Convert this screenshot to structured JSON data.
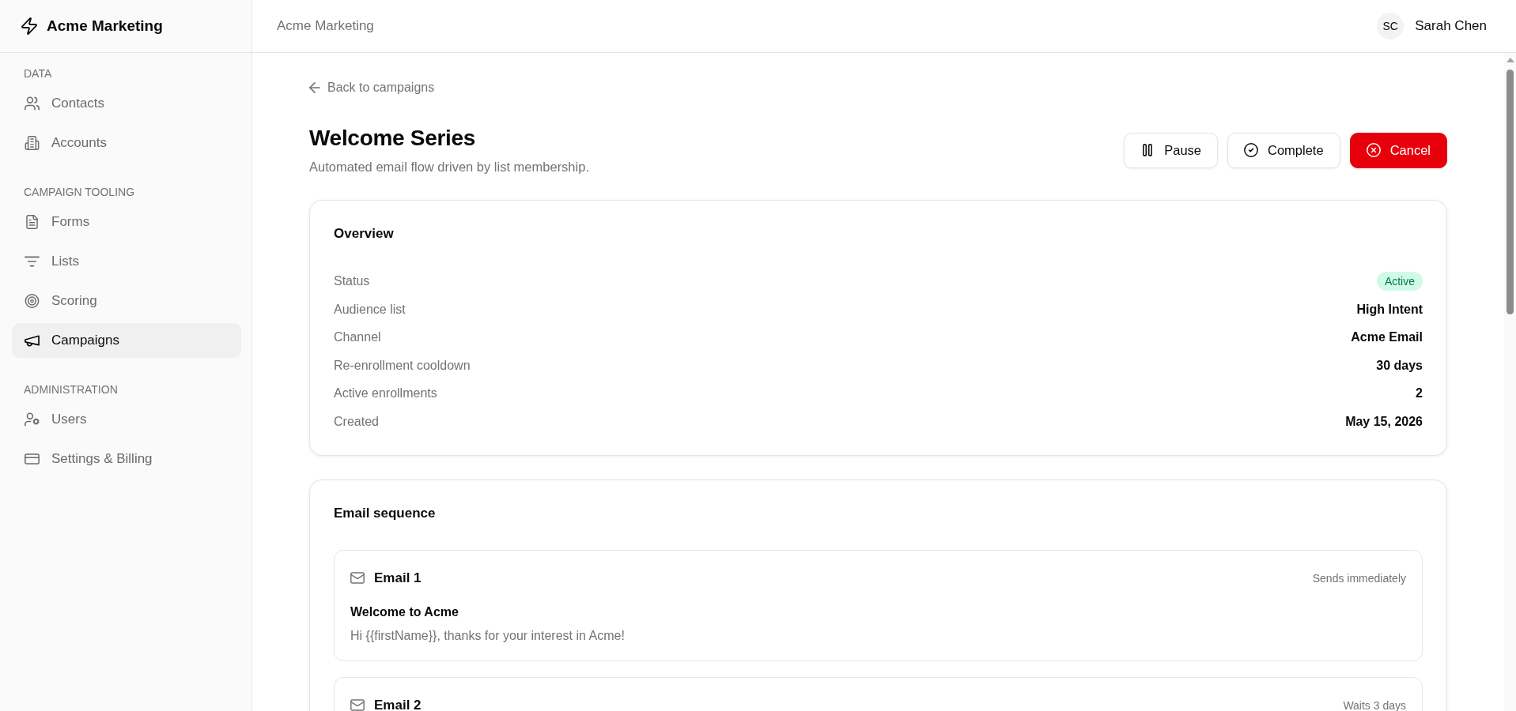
{
  "sidebar": {
    "brand": "Acme Marketing",
    "sections": [
      {
        "label": "DATA",
        "items": [
          {
            "label": "Contacts",
            "selected": false
          },
          {
            "label": "Accounts",
            "selected": false
          }
        ]
      },
      {
        "label": "CAMPAIGN TOOLING",
        "items": [
          {
            "label": "Forms",
            "selected": false
          },
          {
            "label": "Lists",
            "selected": false
          },
          {
            "label": "Scoring",
            "selected": false
          },
          {
            "label": "Campaigns",
            "selected": true
          }
        ]
      },
      {
        "label": "ADMINISTRATION",
        "items": [
          {
            "label": "Users",
            "selected": false
          },
          {
            "label": "Settings & Billing",
            "selected": false
          }
        ]
      }
    ]
  },
  "header": {
    "title": "Acme Marketing",
    "user": {
      "initials": "SC",
      "name": "Sarah Chen"
    }
  },
  "back_link": "Back to campaigns",
  "page": {
    "title": "Welcome Series",
    "subtitle": "Automated email flow driven by list membership."
  },
  "actions": [
    {
      "label": "Pause",
      "kind": "pause"
    },
    {
      "label": "Complete",
      "kind": "complete"
    },
    {
      "label": "Cancel",
      "kind": "cancel"
    }
  ],
  "overview": {
    "title": "Overview",
    "fields": [
      {
        "label": "Status",
        "value": "Active",
        "kind": "badge"
      },
      {
        "label": "Audience list",
        "value": "High Intent",
        "kind": "text"
      },
      {
        "label": "Channel",
        "value": "Acme Email",
        "kind": "text"
      },
      {
        "label": "Re-enrollment cooldown",
        "value": "30 days",
        "kind": "text"
      },
      {
        "label": "Active enrollments",
        "value": "2",
        "kind": "text"
      },
      {
        "label": "Created",
        "value": "May 15, 2026",
        "kind": "text"
      }
    ]
  },
  "email_sequence": {
    "title": "Email sequence",
    "emails": [
      {
        "title": "Email 1",
        "timing": "Sends immediately",
        "subject": "Welcome to Acme",
        "preview": "Hi {{firstName}}, thanks for your interest in Acme!"
      },
      {
        "title": "Email 2",
        "timing": "Waits 3 days"
      }
    ]
  }
}
